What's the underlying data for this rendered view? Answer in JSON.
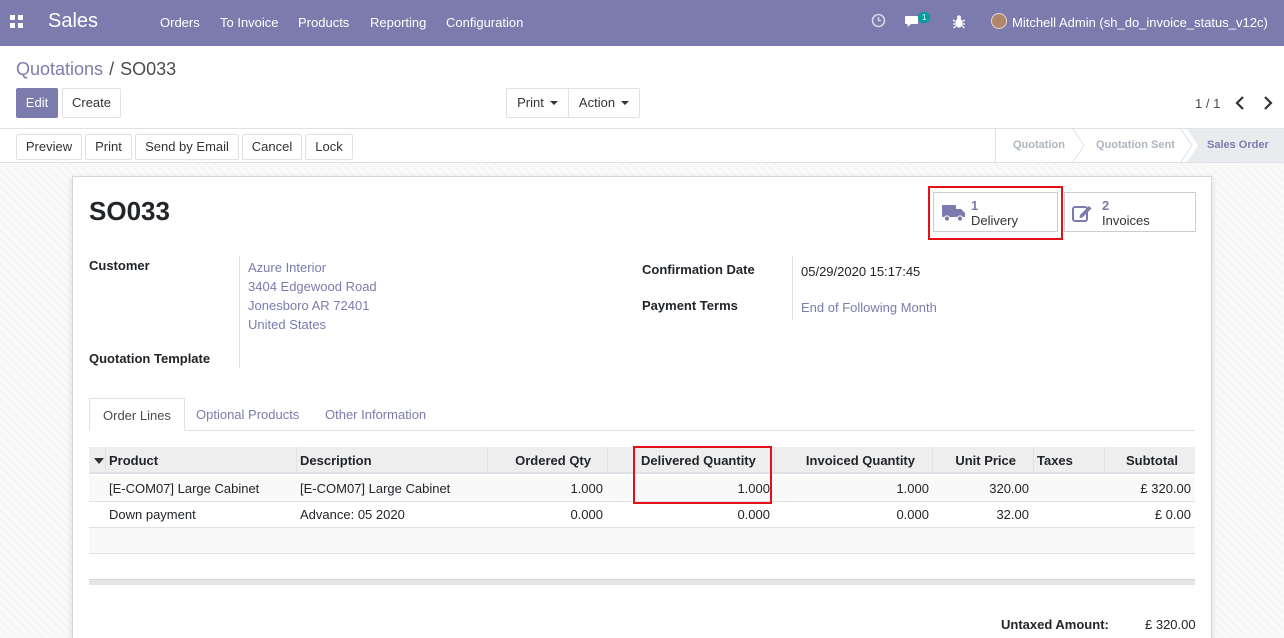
{
  "navbar": {
    "app_name": "Sales",
    "menu": [
      "Orders",
      "To Invoice",
      "Products",
      "Reporting",
      "Configuration"
    ],
    "message_count": "1",
    "user": "Mitchell Admin (sh_do_invoice_status_v12c)",
    "icons": [
      "apps-icon",
      "clock-icon",
      "chat-icon",
      "bug-icon",
      "avatar"
    ]
  },
  "breadcrumb": {
    "parent": "Quotations",
    "separator": "/",
    "current": "SO033"
  },
  "buttons": {
    "edit": "Edit",
    "create": "Create",
    "print": "Print",
    "action": "Action"
  },
  "pager": "1 / 1",
  "status_buttons": [
    "Preview",
    "Print",
    "Send by Email",
    "Cancel",
    "Lock"
  ],
  "stages": [
    "Quotation",
    "Quotation Sent",
    "Sales Order"
  ],
  "active_stage": "Sales Order",
  "smart_buttons": [
    {
      "count": "1",
      "label": "Delivery",
      "icon": "truck-icon"
    },
    {
      "count": "2",
      "label": "Invoices",
      "icon": "edit-icon"
    }
  ],
  "order": {
    "name": "SO033",
    "customer_label": "Customer",
    "customer_lines": [
      "Azure Interior",
      "3404 Edgewood Road",
      "Jonesboro AR 72401",
      "United States"
    ],
    "template_label": "Quotation Template",
    "confirmation_label": "Confirmation Date",
    "confirmation_value": "05/29/2020 15:17:45",
    "payment_terms_label": "Payment Terms",
    "payment_terms_value": "End of Following Month"
  },
  "tabs": [
    "Order Lines",
    "Optional Products",
    "Other Information"
  ],
  "table": {
    "headers": [
      "Product",
      "Description",
      "Ordered Qty",
      "Delivered Quantity",
      "Invoiced Quantity",
      "Unit Price",
      "Taxes",
      "Subtotal"
    ],
    "rows": [
      [
        "[E-COM07] Large Cabinet",
        "[E-COM07] Large Cabinet",
        "1.000",
        "1.000",
        "1.000",
        "320.00",
        "",
        "£ 320.00"
      ],
      [
        "Down payment",
        "Advance: 05 2020",
        "0.000",
        "0.000",
        "0.000",
        "32.00",
        "",
        "£ 0.00"
      ]
    ]
  },
  "totals": {
    "untaxed_label": "Untaxed Amount:",
    "untaxed_value": "£ 320.00"
  },
  "colors": {
    "brand": "#7c7bad",
    "highlight": "#e3101a"
  }
}
